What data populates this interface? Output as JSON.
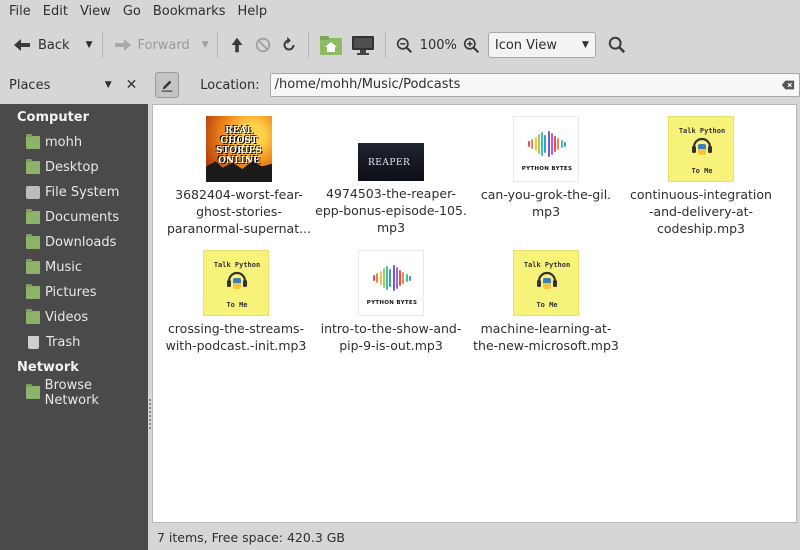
{
  "menubar": {
    "items": [
      "File",
      "Edit",
      "View",
      "Go",
      "Bookmarks",
      "Help"
    ]
  },
  "toolbar": {
    "back_label": "Back",
    "forward_label": "Forward",
    "zoom_level": "100%",
    "view_mode": "Icon View"
  },
  "places": {
    "header": "Places",
    "sections": [
      {
        "title": "Computer",
        "items": [
          {
            "label": "mohh",
            "icon": "home-folder-icon"
          },
          {
            "label": "Desktop",
            "icon": "desktop-folder-icon"
          },
          {
            "label": "File System",
            "icon": "drive-icon"
          },
          {
            "label": "Documents",
            "icon": "documents-folder-icon"
          },
          {
            "label": "Downloads",
            "icon": "downloads-folder-icon"
          },
          {
            "label": "Music",
            "icon": "music-folder-icon"
          },
          {
            "label": "Pictures",
            "icon": "pictures-folder-icon"
          },
          {
            "label": "Videos",
            "icon": "videos-folder-icon"
          },
          {
            "label": "Trash",
            "icon": "trash-icon"
          }
        ]
      },
      {
        "title": "Network",
        "items": [
          {
            "label": "Browse Network",
            "icon": "network-folder-icon"
          }
        ]
      }
    ]
  },
  "location": {
    "label": "Location:",
    "value": "/home/mohh/Music/Podcasts"
  },
  "files": [
    {
      "name_lines": [
        "3682404-worst-fear-",
        "ghost-stories-",
        "paranormal-supernat..."
      ],
      "thumb": "ghost-stories",
      "thumb_text": [
        "REAL",
        "GHOST STORIES",
        "ONLINE"
      ]
    },
    {
      "name_lines": [
        "4974503-the-reaper-",
        "epp-bonus-episode-105.",
        "mp3"
      ],
      "thumb": "reaper",
      "thumb_text": [
        "REAPER"
      ]
    },
    {
      "name_lines": [
        "can-you-grok-the-gil.",
        "mp3"
      ],
      "thumb": "python-bytes",
      "thumb_text": [
        "PYTHON BYTES"
      ]
    },
    {
      "name_lines": [
        "continuous-integration",
        "-and-delivery-at-",
        "codeship.mp3"
      ],
      "thumb": "talk-python",
      "thumb_text": [
        "Talk Python",
        "To Me"
      ]
    },
    {
      "name_lines": [
        "crossing-the-streams-",
        "with-podcast.-init.mp3"
      ],
      "thumb": "talk-python",
      "thumb_text": [
        "Talk Python",
        "To Me"
      ]
    },
    {
      "name_lines": [
        "intro-to-the-show-and-",
        "pip-9-is-out.mp3"
      ],
      "thumb": "python-bytes",
      "thumb_text": [
        "PYTHON BYTES"
      ]
    },
    {
      "name_lines": [
        "machine-learning-at-",
        "the-new-microsoft.mp3"
      ],
      "thumb": "talk-python",
      "thumb_text": [
        "Talk Python",
        "To Me"
      ]
    }
  ],
  "status": {
    "text": "7 items, Free space: 420.3 GB"
  }
}
